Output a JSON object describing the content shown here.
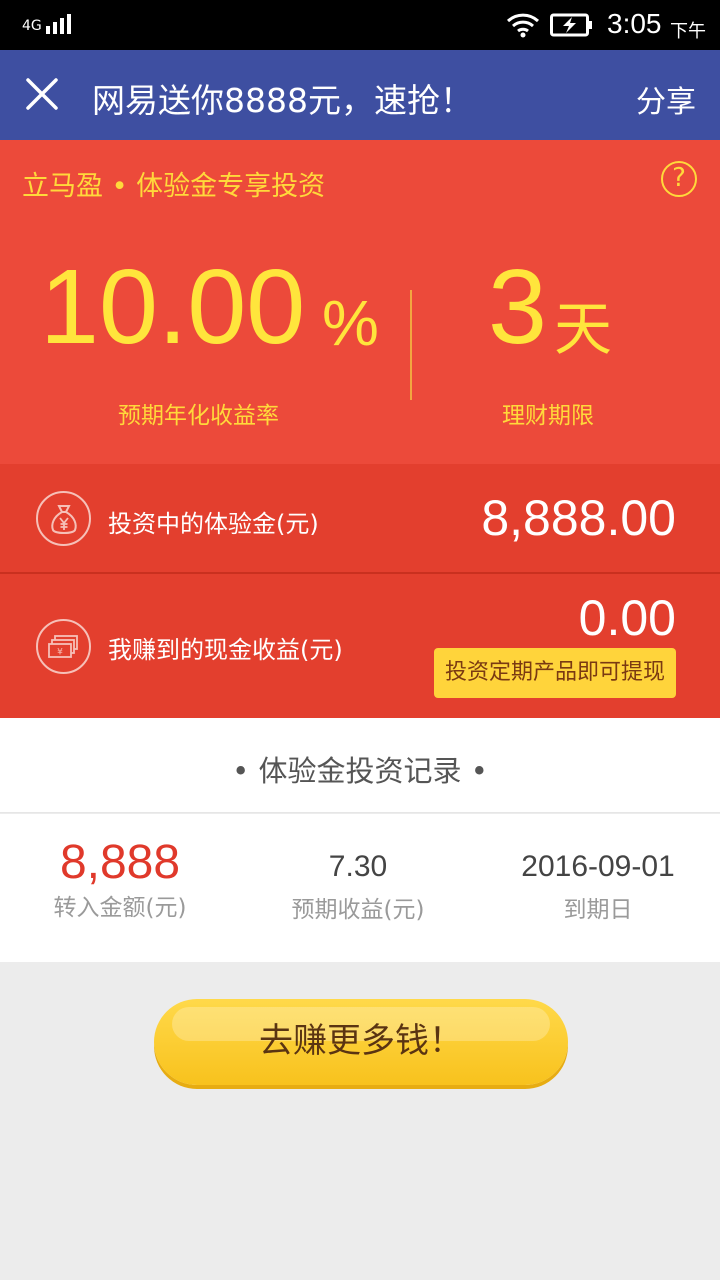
{
  "status_bar": {
    "network": "4G",
    "time": "3:05",
    "ampm": "下午"
  },
  "topbar": {
    "title": "网易送你8888元，速抢！",
    "share": "分享"
  },
  "hero": {
    "title": "立马盈 • 体验金专享投资",
    "help": "?",
    "rate_value": "10.00",
    "rate_unit": "%",
    "rate_label": "预期年化收益率",
    "term_value": "3",
    "term_unit": "天",
    "term_label": "理财期限"
  },
  "summary": {
    "invested_label": "投资中的体验金(元)",
    "invested_value": "8,888.00",
    "earned_label": "我赚到的现金收益(元)",
    "earned_value": "0.00",
    "withdraw_button": "投资定期产品即可提现"
  },
  "records": {
    "title": "• 体验金投资记录 •",
    "items": [
      {
        "amount": "8,888",
        "amount_label": "转入金额(元)",
        "expected": "7.30",
        "expected_label": "预期收益(元)",
        "due_date": "2016-09-01",
        "due_label": "到期日"
      }
    ]
  },
  "cta": {
    "label": "去赚更多钱！"
  },
  "colors": {
    "topbar": "#3e4fa1",
    "hero": "#ec4a3a",
    "rows": "#e33f2e",
    "accent_yellow": "#ffd43b"
  }
}
